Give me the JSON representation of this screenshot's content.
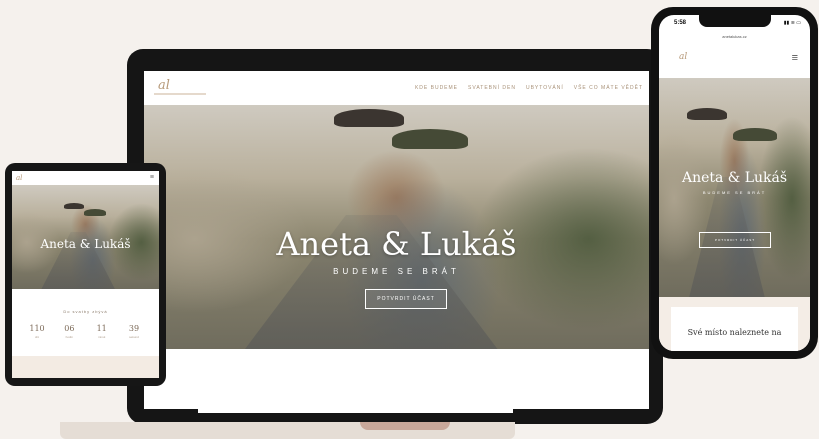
{
  "laptop": {
    "logo": "al",
    "menu": [
      "KDE BUDEME",
      "SVATEBNÍ DEN",
      "UBYTOVÁNÍ",
      "VŠE CO MÁTE VĚDĚT"
    ],
    "hero_title": "Aneta & Lukáš",
    "hero_subtitle": "BUDEME SE BRÁT",
    "hero_button": "POTVRDIT ÚČAST"
  },
  "tablet": {
    "logo": "al",
    "menu_icon": "hamburger-icon",
    "hero_title": "Aneta & Lukáš",
    "countdown_label": "Do svatby zbývá",
    "countdown": [
      {
        "value": "110",
        "unit": "dní"
      },
      {
        "value": "06",
        "unit": "hodin"
      },
      {
        "value": "11",
        "unit": "minut"
      },
      {
        "value": "39",
        "unit": "sekund"
      }
    ]
  },
  "phone": {
    "time": "5:58",
    "status_icons": "▮▮ ≋ ▭",
    "url": "anetalukas.cz",
    "logo": "al",
    "menu_icon": "hamburger-icon",
    "hero_title": "Aneta & Lukáš",
    "hero_subtitle": "BUDEME SE BRÁT",
    "hero_button": "POTVRDIT ÚČAST",
    "section_text": "Své místo naleznete na"
  },
  "colors": {
    "accent": "#b79a7a",
    "background": "#f5f1ed"
  }
}
